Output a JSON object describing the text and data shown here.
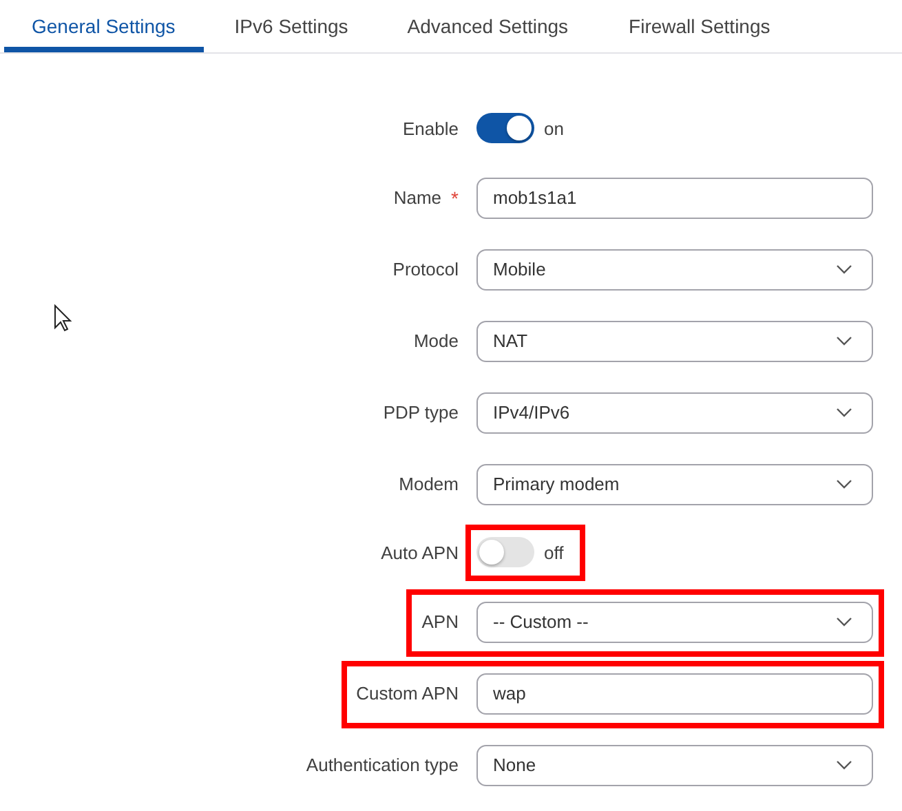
{
  "tabs": [
    {
      "label": "General Settings",
      "selected": true
    },
    {
      "label": "IPv6 Settings",
      "selected": false
    },
    {
      "label": "Advanced Settings",
      "selected": false
    },
    {
      "label": "Firewall Settings",
      "selected": false
    }
  ],
  "fields": [
    {
      "kind": "toggle",
      "label": "Enable",
      "on": true,
      "state_text": "on",
      "highlighted": false
    },
    {
      "kind": "text",
      "label": "Name",
      "required_mark": "*",
      "value": "mob1s1a1",
      "highlighted": false
    },
    {
      "kind": "select",
      "label": "Protocol",
      "value": "Mobile",
      "highlighted": false
    },
    {
      "kind": "select",
      "label": "Mode",
      "value": "NAT",
      "highlighted": false
    },
    {
      "kind": "select",
      "label": "PDP type",
      "value": "IPv4/IPv6",
      "highlighted": false
    },
    {
      "kind": "select",
      "label": "Modem",
      "value": "Primary modem",
      "highlighted": false
    },
    {
      "kind": "toggle",
      "label": "Auto APN",
      "on": false,
      "state_text": "off",
      "highlighted": true
    },
    {
      "kind": "select",
      "label": "APN",
      "value": "-- Custom --",
      "highlighted": true
    },
    {
      "kind": "text",
      "label": "Custom APN",
      "value": "wap",
      "highlighted": true
    },
    {
      "kind": "select",
      "label": "Authentication type",
      "value": "None",
      "highlighted": false
    }
  ]
}
